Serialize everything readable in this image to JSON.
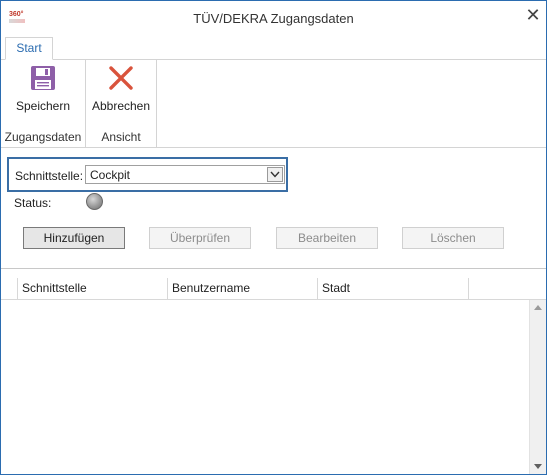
{
  "window": {
    "title": "TÜV/DEKRA Zugangsdaten",
    "logo_text": "360°",
    "close_glyph": "✕"
  },
  "tabs": [
    {
      "label": "Start",
      "active": true
    }
  ],
  "ribbon": {
    "groups": [
      {
        "label": "Zugangsdaten",
        "button": {
          "label": "Speichern",
          "icon": "save-icon",
          "color": "#8e5fa8"
        }
      },
      {
        "label": "Ansicht",
        "button": {
          "label": "Abbrechen",
          "icon": "close-x-icon",
          "color": "#d9533c"
        }
      }
    ]
  },
  "form": {
    "interface_label": "Schnittstelle:",
    "interface_value": "Cockpit",
    "status_label": "Status:",
    "status_color": "#9a9a9a"
  },
  "buttons": {
    "add": "Hinzufügen",
    "check": "Überprüfen",
    "edit": "Bearbeiten",
    "delete": "Löschen"
  },
  "table": {
    "columns": [
      "Schnittstelle",
      "Benutzername",
      "Stadt"
    ],
    "rows": []
  },
  "colors": {
    "accent": "#2b6cb0",
    "focus_frame": "#3a6ea5"
  }
}
